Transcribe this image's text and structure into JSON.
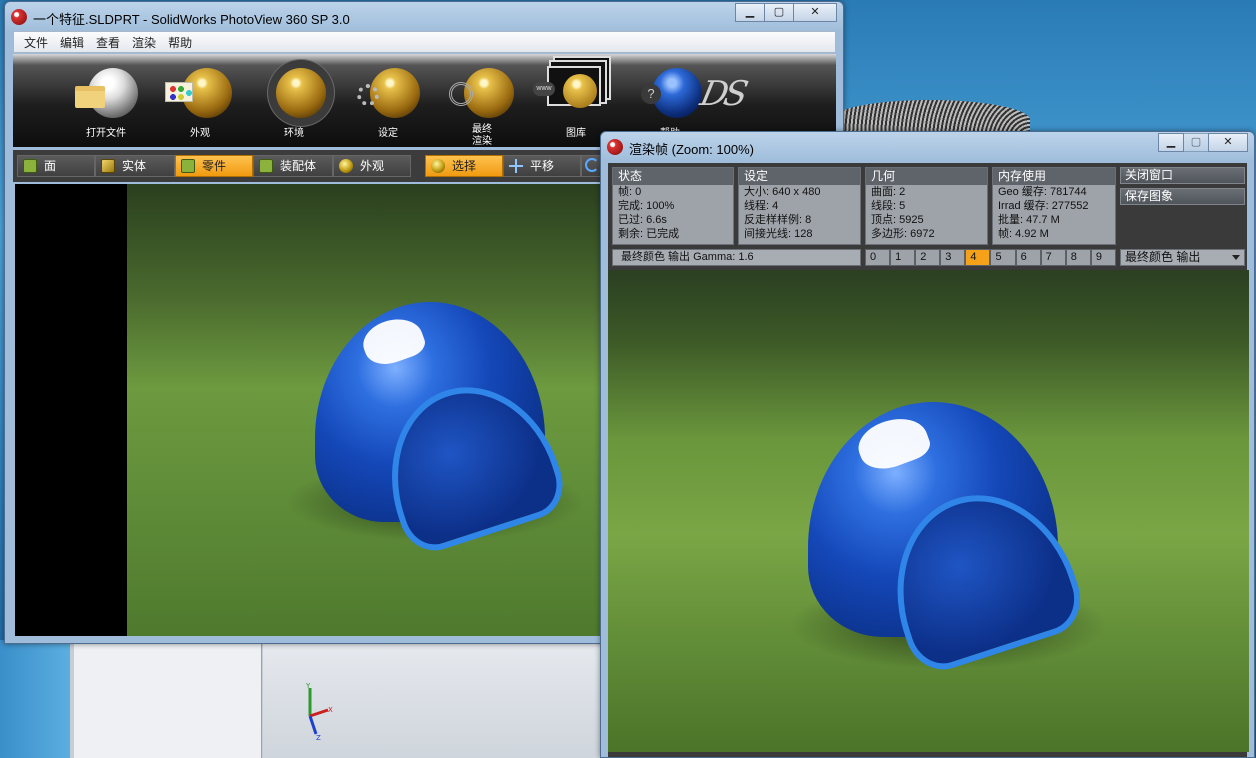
{
  "main_window": {
    "title": "一个特征.SLDPRT - SolidWorks PhotoView 360 SP 3.0",
    "menu": [
      "文件",
      "编辑",
      "查看",
      "渲染",
      "帮助"
    ],
    "toolbar": [
      {
        "label": "打开文件",
        "icon": "open-file-icon"
      },
      {
        "label": "外观",
        "icon": "appearance-icon"
      },
      {
        "label": "环境",
        "icon": "environment-icon"
      },
      {
        "label": "设定",
        "icon": "settings-icon"
      },
      {
        "label": "最终\n渲染",
        "icon": "final-render-icon"
      },
      {
        "label": "图库",
        "icon": "gallery-icon"
      },
      {
        "label": "帮助",
        "icon": "help-icon"
      }
    ],
    "tabs": [
      "面",
      "实体",
      "零件",
      "装配体",
      "外观",
      "选择",
      "平移"
    ],
    "active_tabs": [
      "零件",
      "选择"
    ]
  },
  "render_window": {
    "title": "渲染帧 (Zoom: 100%)",
    "status": {
      "header": "状态",
      "lines": [
        "帧: 0",
        "完成: 100%",
        "已过: 6.6s",
        "剩余: 已完成"
      ]
    },
    "settings": {
      "header": "设定",
      "lines": [
        "大小: 640 x 480",
        "线程: 4",
        "反走样样例: 8",
        "间接光线: 128"
      ]
    },
    "geometry": {
      "header": "几何",
      "lines": [
        "曲面: 2",
        "线段: 5",
        "顶点: 5925",
        "多边形: 6972"
      ]
    },
    "memory": {
      "header": "内存使用",
      "lines": [
        "Geo 缓存: 781744",
        "Irrad 缓存: 277552",
        "批量: 47.7 M",
        "帧: 4.92 M"
      ]
    },
    "close_button": "关闭窗口",
    "save_button": "保存图象",
    "gamma_label": "最终颜色 输出 Gamma: 1.6",
    "frames": [
      "0",
      "1",
      "2",
      "3",
      "4",
      "5",
      "6",
      "7",
      "8",
      "9"
    ],
    "active_frame": "4",
    "output_select": "最终颜色 输出"
  },
  "colors": {
    "accent": "#f5a21a",
    "helmet": "#1447b8",
    "ground": "#6a963c"
  }
}
